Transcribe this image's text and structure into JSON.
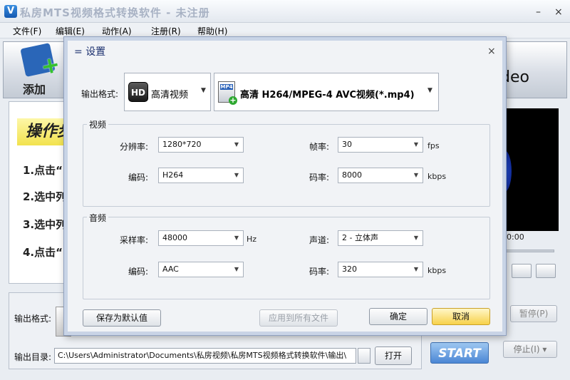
{
  "app": {
    "title": "私房MTS视频格式转换软件 - 未注册",
    "icon_letter": "V",
    "win_min": "–",
    "win_close": "×"
  },
  "menu": [
    "文件(F)",
    "编辑(E)",
    "动作(A)",
    "注册(R)",
    "帮助(H)"
  ],
  "toolbar": {
    "add_label": "添加",
    "right_text": "deo"
  },
  "steps": {
    "title": "操作步",
    "items": [
      "1.点击“",
      "2.选中列",
      "3.选中列",
      "4.点击“"
    ]
  },
  "preview": {
    "time": "00:00"
  },
  "controls": {
    "pause_label": "暂停(P)",
    "stop_label": "停止(I)",
    "stop_arrow": "▾",
    "start_label": "START"
  },
  "output": {
    "format_label": "输出格式:",
    "dir_label": "输出目录:",
    "dir_value": "C:\\Users\\Administrator\\Documents\\私房视频\\私房MTS视频格式转换软件\\输出\\",
    "open_label": "打开"
  },
  "dialog": {
    "title_prefix": "=",
    "title": "设置",
    "close": "×",
    "format_label": "输出格式:",
    "format_category": "高清视频",
    "format_category_icon": "HD",
    "format_value": "高清 H264/MPEG-4 AVC视频(*.mp4)",
    "video": {
      "group_title": "视频",
      "resolution_label": "分辨率:",
      "resolution": "1280*720",
      "framerate_label": "帧率:",
      "framerate": "30",
      "framerate_unit": "fps",
      "codec_label": "编码:",
      "codec": "H264",
      "bitrate_label": "码率:",
      "bitrate": "8000",
      "bitrate_unit": "kbps"
    },
    "audio": {
      "group_title": "音频",
      "samplerate_label": "采样率:",
      "samplerate": "48000",
      "samplerate_unit": "Hz",
      "channels_label": "声道:",
      "channels": "2 - 立体声",
      "codec_label": "编码:",
      "codec": "AAC",
      "bitrate_label": "码率:",
      "bitrate": "320",
      "bitrate_unit": "kbps"
    },
    "buttons": {
      "save_default": "保存为默认值",
      "apply_all": "应用到所有文件",
      "ok": "确定",
      "cancel": "取消"
    }
  }
}
